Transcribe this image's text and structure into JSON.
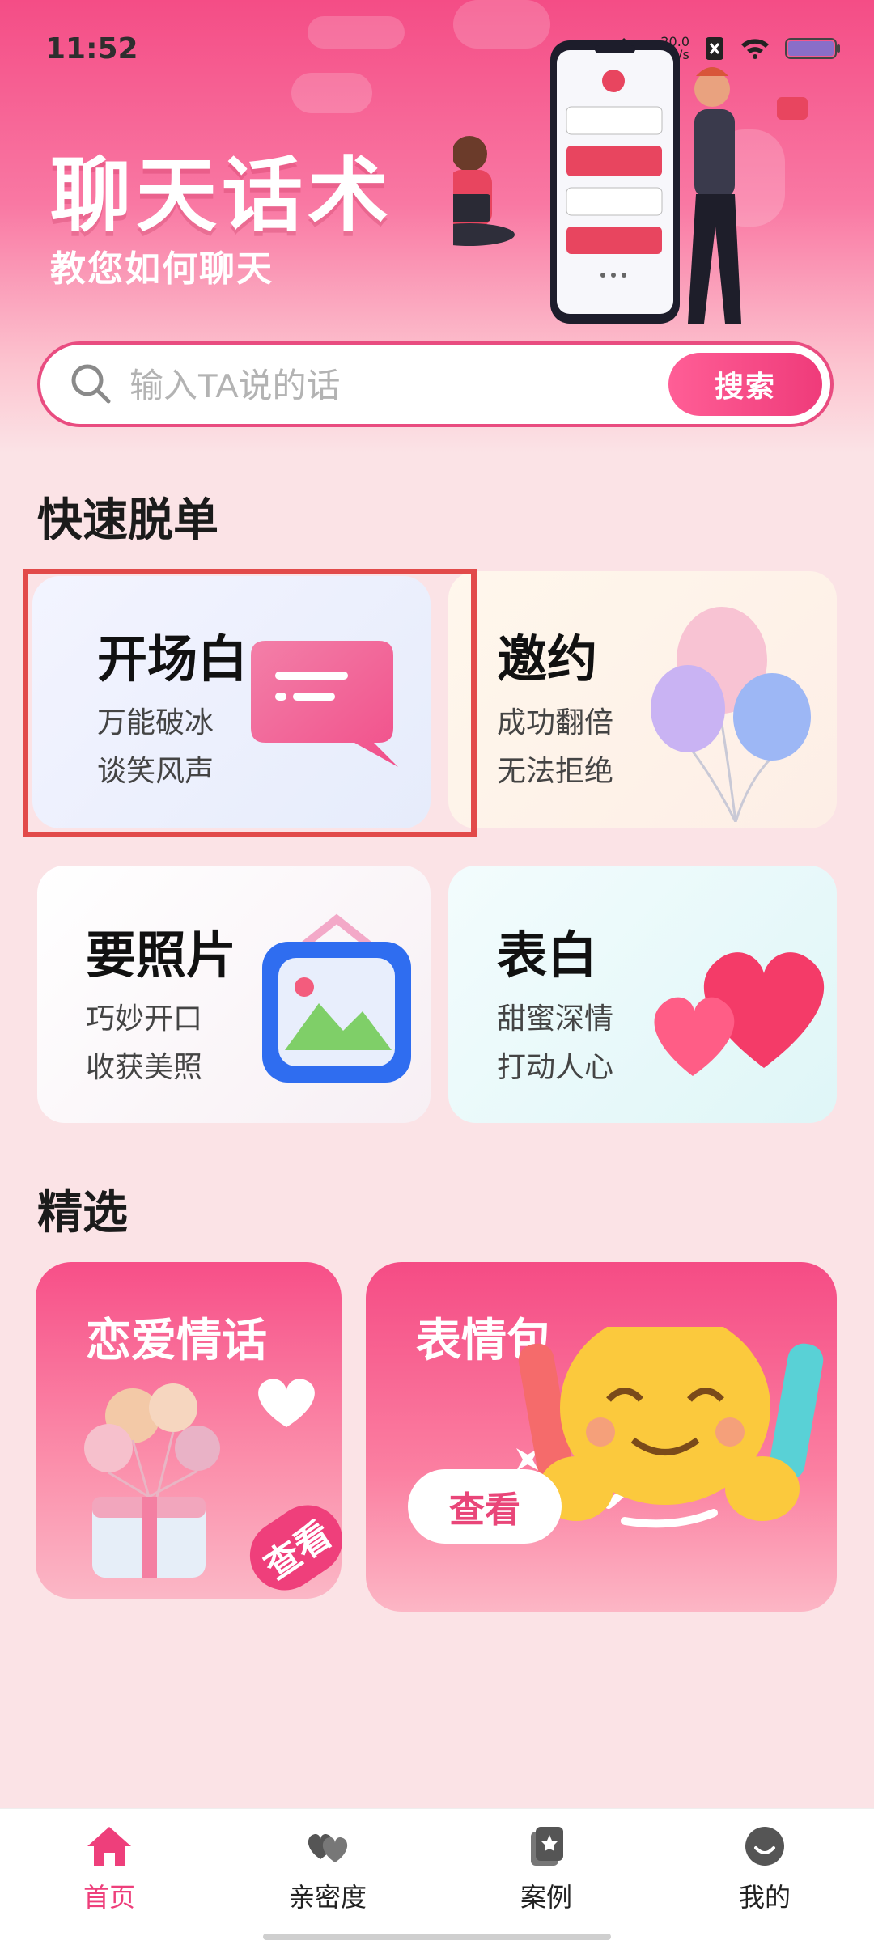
{
  "status_bar": {
    "time": "11:52",
    "net_speed": "20.0",
    "net_unit": "KB/s"
  },
  "header": {
    "title": "聊天话术",
    "subtitle": "教您如何聊天"
  },
  "search": {
    "placeholder": "输入TA说的话",
    "button_label": "搜索"
  },
  "quick_section": {
    "title": "快速脱单",
    "cards": [
      {
        "title": "开场白",
        "line1": "万能破冰",
        "line2": "谈笑风声"
      },
      {
        "title": "邀约",
        "line1": "成功翻倍",
        "line2": "无法拒绝"
      },
      {
        "title": "要照片",
        "line1": "巧妙开口",
        "line2": "收获美照"
      },
      {
        "title": "表白",
        "line1": "甜蜜深情",
        "line2": "打动人心"
      }
    ]
  },
  "featured_section": {
    "title": "精选",
    "cards": [
      {
        "title": "恋爱情话",
        "button": "查看"
      },
      {
        "title": "表情包",
        "button": "查看"
      }
    ]
  },
  "bottom_nav": {
    "items": [
      {
        "label": "首页",
        "icon": "home-icon",
        "active": true
      },
      {
        "label": "亲密度",
        "icon": "hearts-icon",
        "active": false
      },
      {
        "label": "案例",
        "icon": "cards-icon",
        "active": false
      },
      {
        "label": "我的",
        "icon": "smile-icon",
        "active": false
      }
    ]
  },
  "colors": {
    "accent": "#ee3f7b",
    "highlight_box": "#e24a4a"
  }
}
